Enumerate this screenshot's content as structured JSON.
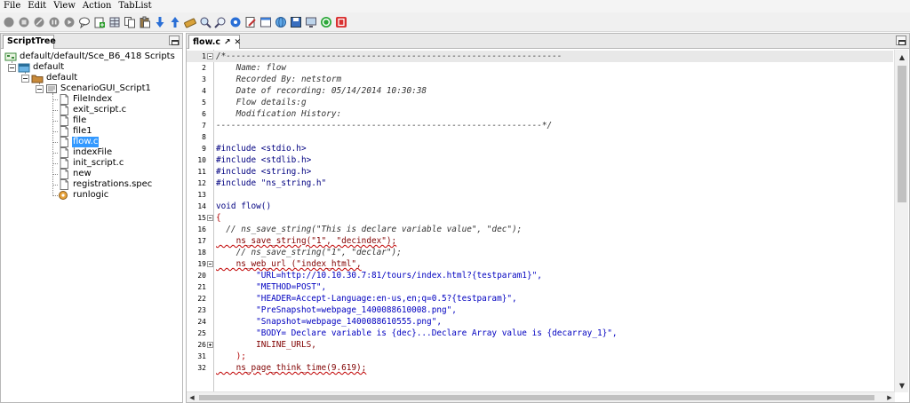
{
  "menu": [
    "File",
    "Edit",
    "View",
    "Action",
    "TabList"
  ],
  "toolbar": {
    "icons": [
      "record-icon",
      "stop-icon",
      "cancel-icon",
      "pause-icon",
      "play-icon",
      "comment-icon",
      "add-page-icon",
      "grid-icon",
      "copy-icon",
      "paste-icon",
      "download-icon",
      "upload-icon",
      "settings-script-icon",
      "zoom-icon",
      "search-icon",
      "gear-icon",
      "edit-icon",
      "window-icon",
      "internet-icon",
      "save-icon",
      "screen-icon",
      "go-icon",
      "app-icon"
    ]
  },
  "left_panel": {
    "tab_label": "ScriptTree",
    "tree": [
      {
        "label": "default/default/Sce_B6_418 Scripts",
        "icon": "scenario-root-icon"
      },
      {
        "label": "default",
        "icon": "project-icon"
      },
      {
        "label": "default",
        "icon": "folder-icon"
      },
      {
        "label": "ScenarioGUI_Script1",
        "icon": "script-icon"
      },
      {
        "label": "FileIndex",
        "icon": "file-icon"
      },
      {
        "label": "exit_script.c",
        "icon": "file-icon"
      },
      {
        "label": "file",
        "icon": "file-icon"
      },
      {
        "label": "file1",
        "icon": "file-icon"
      },
      {
        "label": "flow.c",
        "icon": "file-icon",
        "selected": true
      },
      {
        "label": "indexFile",
        "icon": "file-icon"
      },
      {
        "label": "init_script.c",
        "icon": "file-icon"
      },
      {
        "label": "new",
        "icon": "file-icon"
      },
      {
        "label": "registrations.spec",
        "icon": "file-icon"
      },
      {
        "label": "runlogic",
        "icon": "runlogic-icon"
      }
    ]
  },
  "editor": {
    "tab_label": "flow.c",
    "lines": [
      {
        "num": "1",
        "fold": "minus",
        "text": "/*-------------------------------------------------------------------",
        "cls": "c-comment",
        "current": true
      },
      {
        "num": "2",
        "text": "    Name: flow",
        "cls": "c-comment"
      },
      {
        "num": "3",
        "text": "    Recorded By: netstorm",
        "cls": "c-comment"
      },
      {
        "num": "4",
        "text": "    Date of recording: 05/14/2014 10:30:38",
        "cls": "c-comment"
      },
      {
        "num": "5",
        "text": "    Flow details:g",
        "cls": "c-comment"
      },
      {
        "num": "6",
        "text": "    Modification History:",
        "cls": "c-comment"
      },
      {
        "num": "7",
        "text": "-----------------------------------------------------------------*/",
        "cls": "c-comment"
      },
      {
        "num": "8",
        "text": "",
        "cls": "c-plain"
      },
      {
        "num": "9",
        "text": "#include <stdio.h>",
        "cls": "c-kw"
      },
      {
        "num": "10",
        "text": "#include <stdlib.h>",
        "cls": "c-kw"
      },
      {
        "num": "11",
        "text": "#include <string.h>",
        "cls": "c-kw"
      },
      {
        "num": "12",
        "text": "#include \"ns_string.h\"",
        "cls": "c-kw"
      },
      {
        "num": "13",
        "text": "",
        "cls": "c-plain"
      },
      {
        "num": "14",
        "text": "void flow()",
        "cls": "c-kw"
      },
      {
        "num": "15",
        "fold": "minus",
        "text": "{",
        "cls": "c-brace"
      },
      {
        "num": "16",
        "text": "  // ns_save_string(\"This is declare variable value\", \"dec\");",
        "cls": "c-comment"
      },
      {
        "num": "17",
        "text": "    ns_save_string(\"1\", \"decindex\");",
        "cls": "c-fn",
        "wavy": true
      },
      {
        "num": "18",
        "text": "    // ns_save_string(\"1\", \"declar\");",
        "cls": "c-comment"
      },
      {
        "num": "19",
        "fold": "minus",
        "text": "    ns_web_url (\"index_html\",",
        "cls": "c-fn",
        "wavy": true
      },
      {
        "num": "20",
        "text": "        \"URL=http://10.10.30.7:81/tours/index.html?{testparam1}\",",
        "cls": "c-str"
      },
      {
        "num": "21",
        "text": "        \"METHOD=POST\",",
        "cls": "c-str"
      },
      {
        "num": "22",
        "text": "        \"HEADER=Accept-Language:en-us,en;q=0.5?{testparam}\",",
        "cls": "c-str"
      },
      {
        "num": "23",
        "text": "        \"PreSnapshot=webpage_1400088610008.png\",",
        "cls": "c-str"
      },
      {
        "num": "24",
        "text": "        \"Snapshot=webpage_1400088610555.png\",",
        "cls": "c-str"
      },
      {
        "num": "25",
        "text": "        \"BODY= Declare variable is {dec}...Declare Array value is {decarray_1}\",",
        "cls": "c-str"
      },
      {
        "num": "26",
        "fold": "plus",
        "text": "        INLINE_URLS,",
        "cls": "c-fn"
      },
      {
        "num": "31",
        "text": "    );",
        "cls": "c-brace"
      },
      {
        "num": "32",
        "text": "    ns_page_think_time(9.619);",
        "cls": "c-fn",
        "wavy": true
      }
    ]
  }
}
